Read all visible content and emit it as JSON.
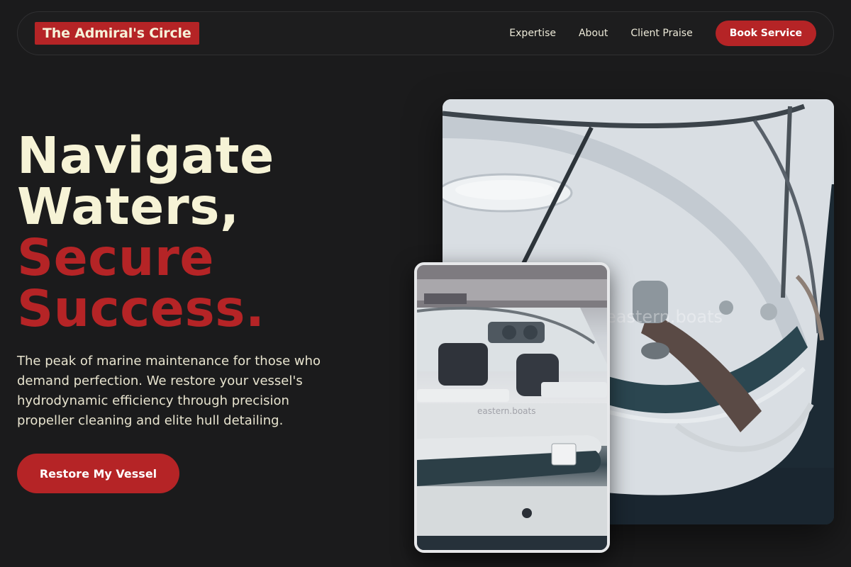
{
  "brand": {
    "name": "The Admiral's Circle"
  },
  "nav": {
    "links": [
      "Expertise",
      "About",
      "Client Praise"
    ],
    "cta": "Book Service"
  },
  "hero": {
    "line1": "Navigate",
    "line2": "Waters,",
    "line3": "Secure",
    "line4": "Success.",
    "description": "The peak of marine maintenance for those who demand perfection. We restore your vessel's hydrodynamic efficiency through precision propeller cleaning and elite hull detailing.",
    "cta": "Restore My Vessel"
  },
  "images": {
    "main_watermark": "eastern.boats",
    "inset_watermark": "eastern.boats"
  },
  "colors": {
    "background": "#1b1b1c",
    "accent": "#b52426",
    "cream": "#f6f3d6"
  }
}
